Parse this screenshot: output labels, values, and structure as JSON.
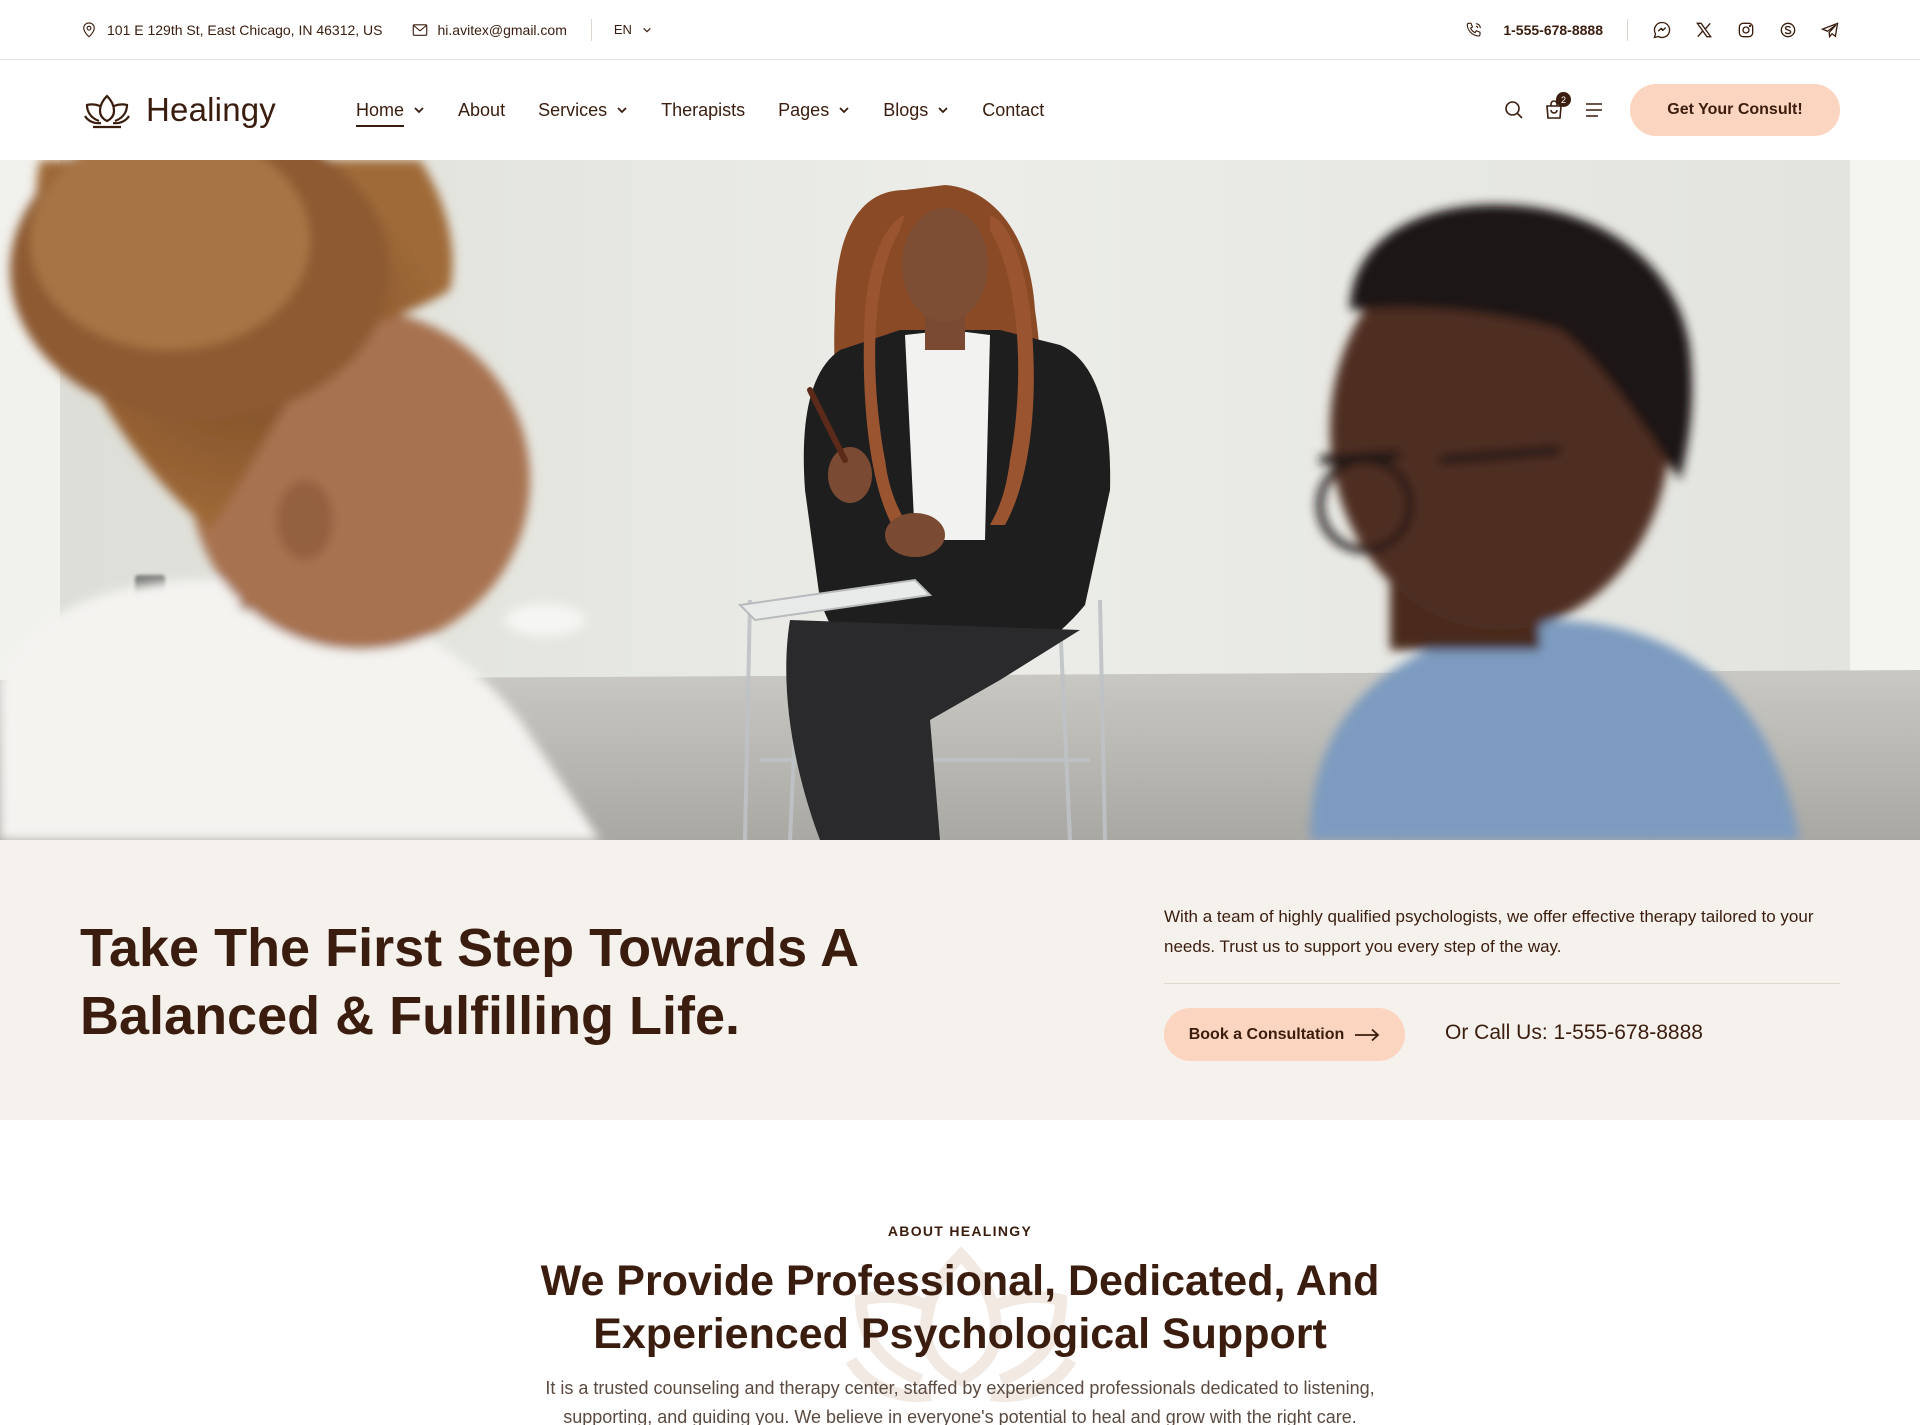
{
  "topbar": {
    "address": "101 E 129th St, East Chicago, IN 46312, US",
    "email": "hi.avitex@gmail.com",
    "language": "EN",
    "phone": "1-555-678-8888",
    "socials": [
      "messenger-icon",
      "x-icon",
      "instagram-icon",
      "skype-icon",
      "telegram-icon"
    ]
  },
  "nav": {
    "logo_text": "Healingy",
    "items": [
      {
        "label": "Home",
        "dropdown": true,
        "active": true
      },
      {
        "label": "About",
        "dropdown": false
      },
      {
        "label": "Services",
        "dropdown": true
      },
      {
        "label": "Therapists",
        "dropdown": false
      },
      {
        "label": "Pages",
        "dropdown": true
      },
      {
        "label": "Blogs",
        "dropdown": true
      },
      {
        "label": "Contact",
        "dropdown": false
      }
    ],
    "cart_count": "2",
    "cta_label": "Get Your Consult!"
  },
  "hero": {
    "image": "therapy-session-photo"
  },
  "intro": {
    "title": "Take The First Step Towards A Balanced & Fulfilling Life.",
    "description": "With a team of highly qualified psychologists, we offer effective therapy tailored to your needs. Trust us to support you every step of the way.",
    "book_label": "Book a Consultation",
    "call_text": "Or Call Us: 1-555-678-8888"
  },
  "about": {
    "eyebrow": "ABOUT HEALINGY",
    "title": "We Provide Professional, Dedicated, And Experienced Psychological Support",
    "text": "It is a trusted counseling and therapy center, staffed by experienced professionals dedicated to listening, supporting, and guiding you. We believe in everyone's potential to heal and grow with the right care."
  },
  "colors": {
    "brand_dark": "#3a1d0e",
    "accent_peach": "#fcd5c0",
    "band_bg": "#f5f1ec"
  }
}
